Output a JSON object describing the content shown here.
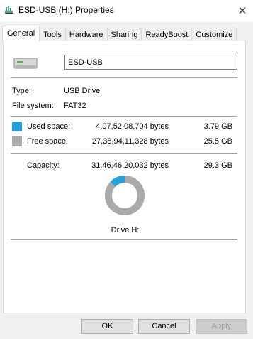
{
  "window": {
    "title": "ESD-USB (H:) Properties",
    "close_glyph": "✕",
    "icon": "properties-icon"
  },
  "tabs": [
    {
      "label": "General",
      "active": true
    },
    {
      "label": "Tools",
      "active": false
    },
    {
      "label": "Hardware",
      "active": false
    },
    {
      "label": "Sharing",
      "active": false
    },
    {
      "label": "ReadyBoost",
      "active": false
    },
    {
      "label": "Customize",
      "active": false
    }
  ],
  "general": {
    "drive_icon": "usb-drive-icon",
    "volume_name": "ESD-USB",
    "type_label": "Type:",
    "type_value": "USB Drive",
    "fs_label": "File system:",
    "fs_value": "FAT32",
    "used_label": "Used space:",
    "used_bytes": "4,07,52,08,704 bytes",
    "used_gb": "3.79 GB",
    "free_label": "Free space:",
    "free_bytes": "27,38,94,11,328 bytes",
    "free_gb": "25.5 GB",
    "capacity_label": "Capacity:",
    "capacity_bytes": "31,46,46,20,032 bytes",
    "capacity_gb": "29.3 GB",
    "used_fraction": 0.1295,
    "drive_label": "Drive H:"
  },
  "colors": {
    "used": "#26a0da",
    "free": "#aaaaaa"
  },
  "buttons": {
    "ok": "OK",
    "cancel": "Cancel",
    "apply": "Apply"
  }
}
